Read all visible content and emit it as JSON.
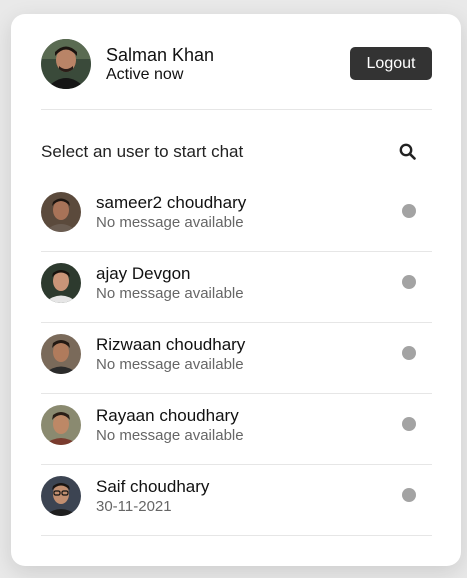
{
  "current_user": {
    "name": "Salman Khan",
    "status": "Active now",
    "avatar_icon": "user-avatar-photo"
  },
  "header": {
    "logout_label": "Logout"
  },
  "search": {
    "prompt": "Select an user to start chat",
    "icon": "search-icon"
  },
  "colors": {
    "logout_bg": "#333333",
    "status_dot": "#a3a3a3",
    "page_bg": "#e9e9e9",
    "card_bg": "#ffffff"
  },
  "users": [
    {
      "name": "sameer2 choudhary",
      "last_message": "No message available"
    },
    {
      "name": "ajay Devgon",
      "last_message": "No message available"
    },
    {
      "name": "Rizwaan choudhary",
      "last_message": "No message available"
    },
    {
      "name": "Rayaan choudhary",
      "last_message": "No message available"
    },
    {
      "name": "Saif choudhary",
      "last_message": "30-11-2021"
    }
  ]
}
